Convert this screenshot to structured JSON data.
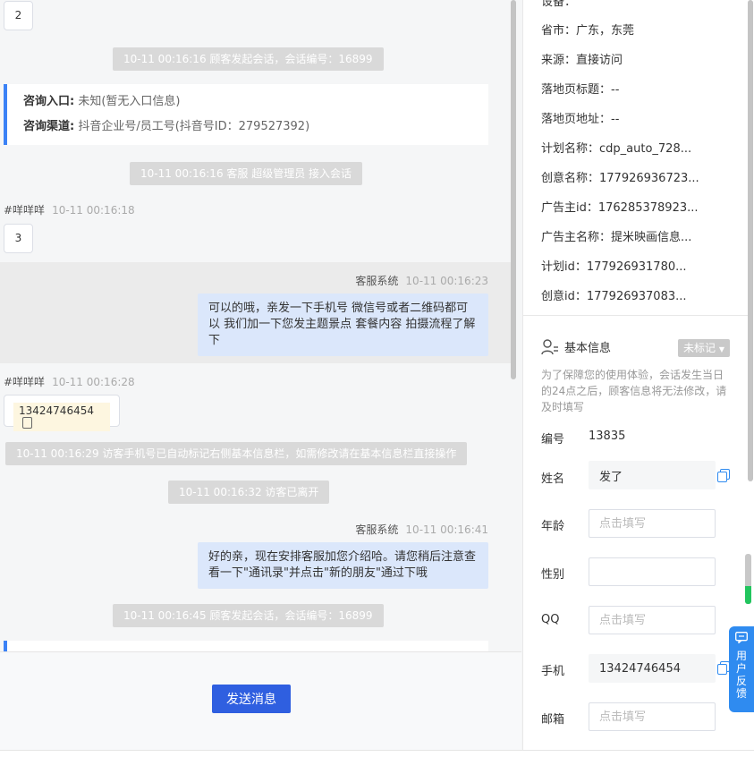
{
  "chat": {
    "bubble_2": "2",
    "sys1": "10-11 00:16:16 顾客发起会话，会话编号：16899",
    "info_card": {
      "entry_label": "咨询入口:",
      "entry_value": "未知(暂无入口信息)",
      "channel_label": "咨询渠道:",
      "channel_value": "抖音企业号/员工号(抖音号ID：279527392)"
    },
    "sys2": "10-11 00:16:16 客服 超级管理员 接入会话",
    "visitor_name": "#咩咩咩",
    "visitor_time1": "10-11 00:16:18",
    "bubble_3": "3",
    "agent_name": "客服系统",
    "agent_time1": "10-11 00:16:23",
    "agent_msg1": "可以的哦，亲发一下手机号 微信号或者二维码都可以 我们加一下您发主题景点 套餐内容 拍摄流程了解下",
    "visitor_time2": "10-11 00:16:28",
    "phone_msg": "13424746454",
    "sys3": "10-11 00:16:29 访客手机号已自动标记右侧基本信息栏，如需修改请在基本信息栏直接操作",
    "sys4": "10-11 00:16:32 访客已离开",
    "agent_time2": "10-11 00:16:41",
    "agent_msg2": "好的亲，现在安排客服加您介绍哈。请您稍后注意查看一下\"通讯录\"并点击\"新的朋友\"通过下哦",
    "sys5": "10-11 00:16:45 顾客发起会话，会话编号：16899"
  },
  "composer": {
    "send_label": "发送消息"
  },
  "right_panel": {
    "source_info": [
      "设备：",
      "省市：广东，东莞",
      "来源：直接访问",
      "落地页标题：--",
      "落地页地址：--",
      "计划名称：cdp_auto_728...",
      "创意名称：177926936723...",
      "广告主id：176285378923...",
      "广告主名称：提米映画信息...",
      "计划id：177926931780...",
      "创意id：177926937083..."
    ],
    "basic_info_title": "基本信息",
    "unmarked_label": "未标记",
    "notice": "为了保障您的使用体验，会话发生当日的24点之后，顾客信息将无法修改，请及时填写",
    "fields": {
      "id_label": "编号",
      "id_value": "13835",
      "name_label": "姓名",
      "name_value": "发了",
      "age_label": "年龄",
      "age_placeholder": "点击填写",
      "gender_label": "性别",
      "qq_label": "QQ",
      "qq_placeholder": "点击填写",
      "phone_label": "手机",
      "phone_value": "13424746454",
      "email_label": "邮箱",
      "email_placeholder": "点击填写"
    },
    "feedback_label": "用户反馈"
  },
  "colors": {
    "accent": "#2f5fe0",
    "agent_bubble": "#dbe7fb",
    "system_pill": "#d9d9d9",
    "feedback": "#2f8bf0"
  }
}
